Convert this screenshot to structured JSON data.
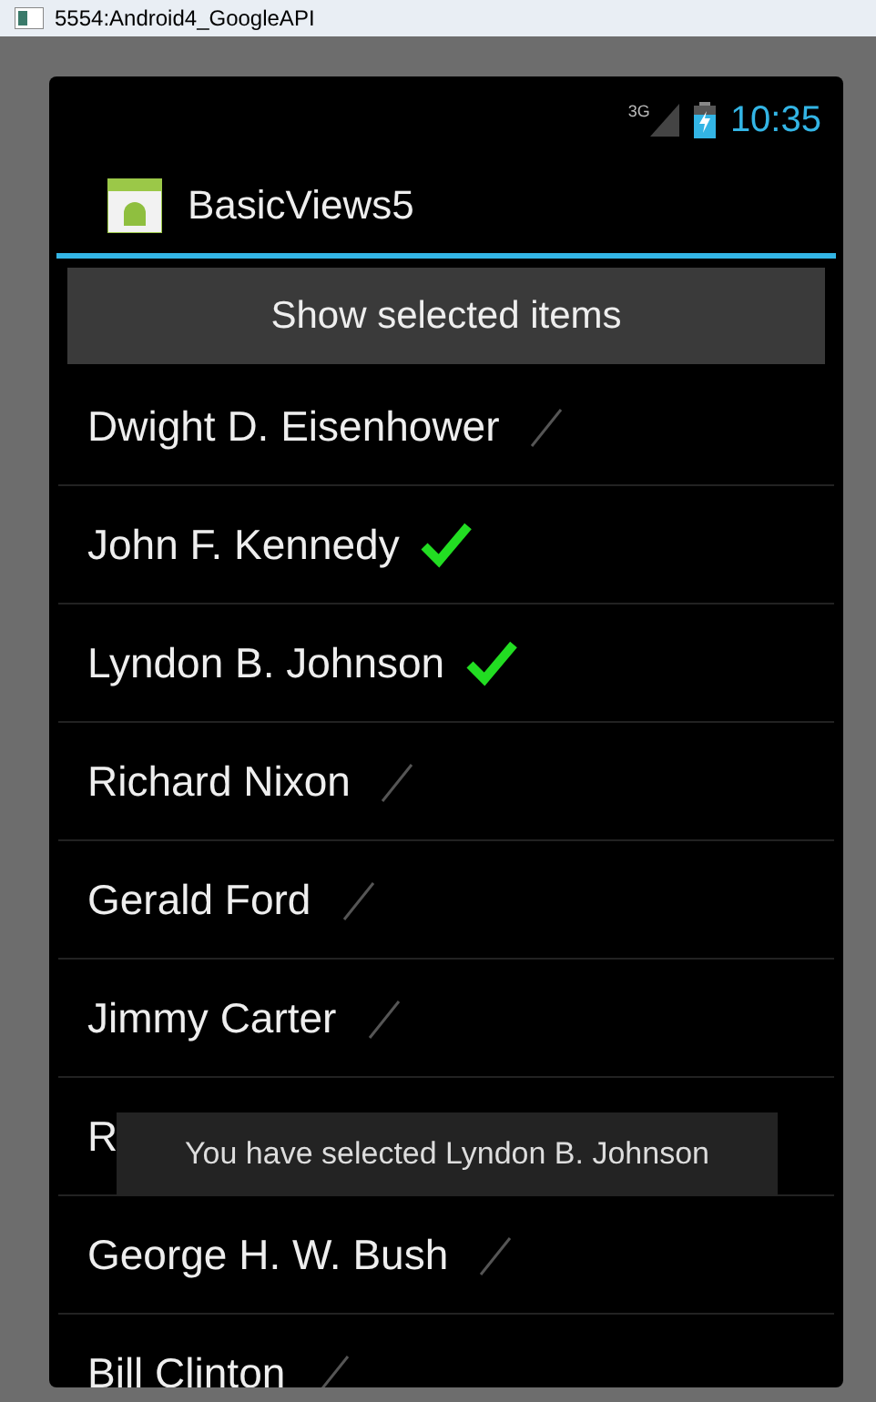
{
  "window": {
    "title": "5554:Android4_GoogleAPI"
  },
  "status_bar": {
    "network": "3G",
    "time": "10:35"
  },
  "action_bar": {
    "title": "BasicViews5"
  },
  "button": {
    "label": "Show selected items"
  },
  "items": [
    {
      "label": "Dwight D. Eisenhower",
      "checked": false
    },
    {
      "label": "John F. Kennedy",
      "checked": true
    },
    {
      "label": "Lyndon B. Johnson",
      "checked": true
    },
    {
      "label": "Richard Nixon",
      "checked": false
    },
    {
      "label": "Gerald Ford",
      "checked": false
    },
    {
      "label": "Jimmy Carter",
      "checked": false
    },
    {
      "label": "R"
    },
    {
      "label": "George H. W. Bush",
      "checked": false
    },
    {
      "label": "Bill Clinton",
      "checked": false
    }
  ],
  "toast": {
    "text": "You have selected Lyndon B. Johnson"
  }
}
